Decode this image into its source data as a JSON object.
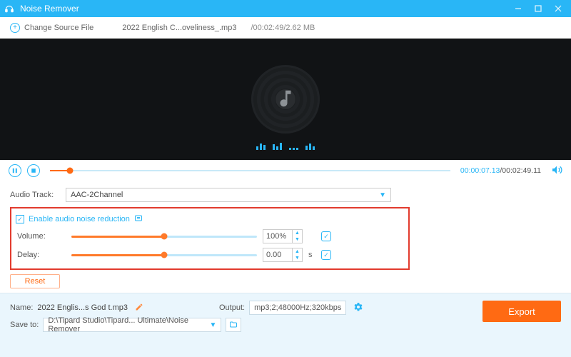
{
  "titlebar": {
    "app_name": "Noise Remover"
  },
  "source": {
    "change_label": "Change Source File",
    "filename": "2022 English C...oveliness_.mp3",
    "info": "/00:02:49/2.62 MB"
  },
  "transport": {
    "current_time": "00:00:07.13",
    "total_time": "/00:02:49.11"
  },
  "audio_track": {
    "label": "Audio Track:",
    "value": "AAC-2Channel"
  },
  "noise": {
    "enable_label": "Enable audio noise reduction"
  },
  "volume": {
    "label": "Volume:",
    "value": "100%",
    "fill_pct": 50
  },
  "delay": {
    "label": "Delay:",
    "value": "0.00",
    "unit": "s",
    "fill_pct": 50
  },
  "reset_label": "Reset",
  "footer": {
    "name_label": "Name:",
    "name_value": "2022 Englis...s God t.mp3",
    "output_label": "Output:",
    "output_value": "mp3;2;48000Hz;320kbps",
    "save_label": "Save to:",
    "save_path": "D:\\Tipard Studio\\Tipard... Ultimate\\Noise Remover",
    "export_label": "Export"
  }
}
